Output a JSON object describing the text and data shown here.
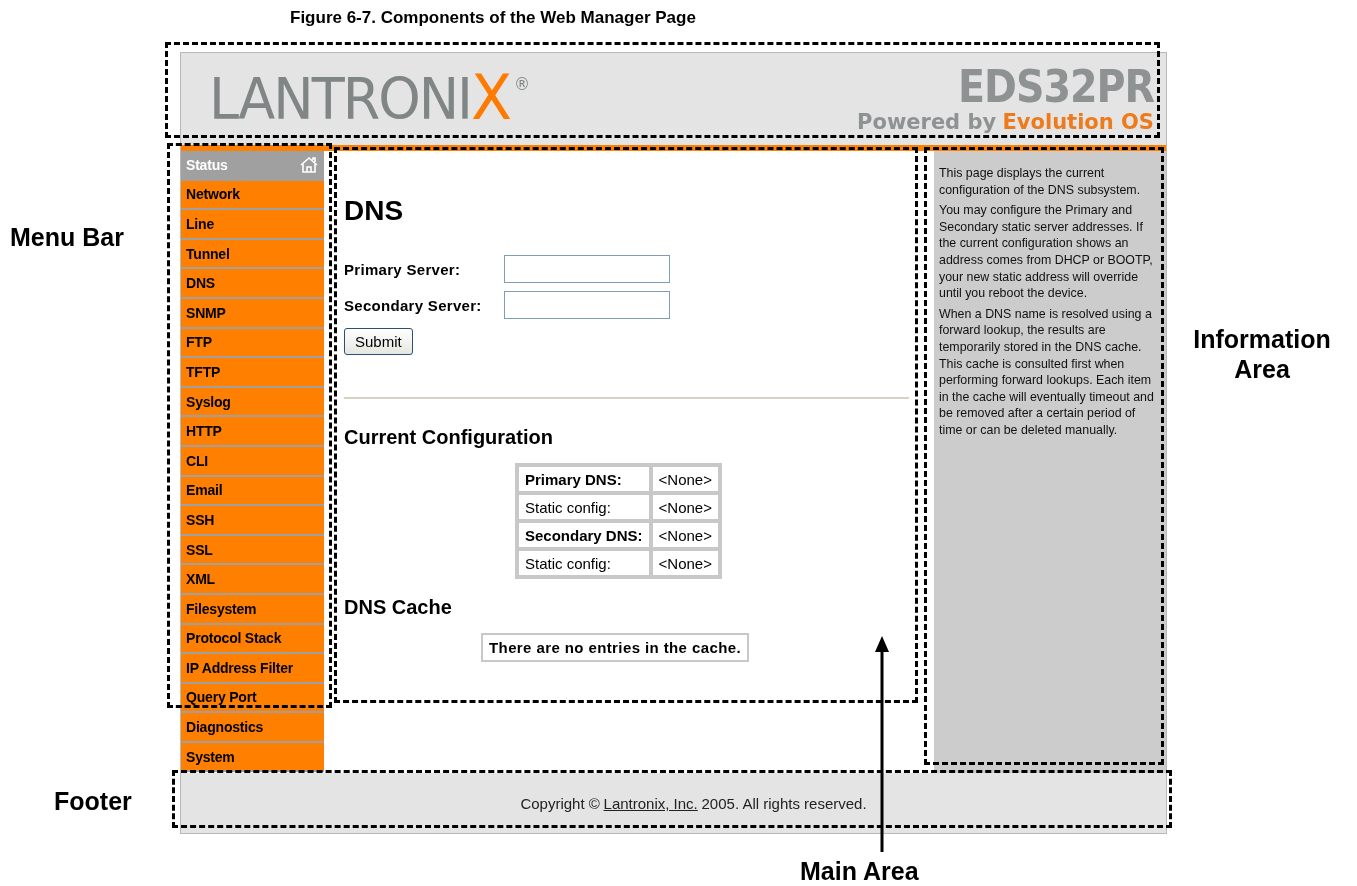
{
  "figure_caption": "Figure 6-7. Components of the Web Manager Page",
  "header": {
    "logo": {
      "text": "LANTRONI",
      "accent": "X",
      "mark": "®"
    },
    "product": "EDS32PR",
    "tagline": {
      "text": "Powered by",
      "accent": "Evolution OS"
    }
  },
  "menu": [
    {
      "label": "Status",
      "kind": "home"
    },
    {
      "label": "Network",
      "kind": "link"
    },
    {
      "label": "Line",
      "kind": "link"
    },
    {
      "label": "Tunnel",
      "kind": "link"
    },
    {
      "label": "DNS",
      "kind": "link"
    },
    {
      "label": "SNMP",
      "kind": "link"
    },
    {
      "label": "FTP",
      "kind": "link"
    },
    {
      "label": "TFTP",
      "kind": "link"
    },
    {
      "label": "Syslog",
      "kind": "link"
    },
    {
      "label": "HTTP",
      "kind": "link"
    },
    {
      "label": "CLI",
      "kind": "link"
    },
    {
      "label": "Email",
      "kind": "link"
    },
    {
      "label": "SSH",
      "kind": "link"
    },
    {
      "label": "SSL",
      "kind": "link"
    },
    {
      "label": "XML",
      "kind": "link"
    },
    {
      "label": "Filesystem",
      "kind": "link"
    },
    {
      "label": "Protocol Stack",
      "kind": "link"
    },
    {
      "label": "IP Address Filter",
      "kind": "link"
    },
    {
      "label": "Query Port",
      "kind": "link"
    },
    {
      "label": "Diagnostics",
      "kind": "link"
    },
    {
      "label": "System",
      "kind": "link"
    }
  ],
  "main": {
    "title": "DNS",
    "fields": [
      {
        "label": "Primary Server:"
      },
      {
        "label": "Secondary Server:"
      }
    ],
    "button": "Submit",
    "config_title": "Current Configuration",
    "config_rows": [
      {
        "label": "Primary DNS:",
        "value": "<None>",
        "kind": "heading"
      },
      {
        "label": "Static config:",
        "value": "<None>",
        "kind": "plain"
      },
      {
        "label": "Secondary DNS:",
        "value": "<None>",
        "kind": "heading"
      },
      {
        "label": "Static config:",
        "value": "<None>",
        "kind": "plain"
      }
    ],
    "cache_title": "DNS Cache",
    "cache_message": "There are no entries in the cache."
  },
  "info": {
    "paragraphs": [
      "This page displays the current configuration of the DNS subsystem.",
      "You may configure the Primary and Secondary static server addresses. If the current configuration shows an address comes from DHCP or BOOTP, your new static address will override until you reboot the device.",
      "When a DNS name is resolved using a forward lookup, the results are temporarily stored in the DNS cache. This cache is consulted first when performing forward lookups. Each item in the cache will eventually timeout and be removed after a certain period of time or can be deleted manually."
    ]
  },
  "footer": {
    "copyright": "Copyright ©",
    "link": "Lantronix, Inc.",
    "rest": "2005. All rights reserved."
  },
  "annotations": [
    {
      "kind": "header"
    },
    {
      "kind": "menu",
      "label": "Menu Bar"
    },
    {
      "kind": "main",
      "label": "Main Area"
    },
    {
      "kind": "info",
      "label": "Information Area"
    },
    {
      "kind": "footer",
      "label": "Footer"
    }
  ]
}
